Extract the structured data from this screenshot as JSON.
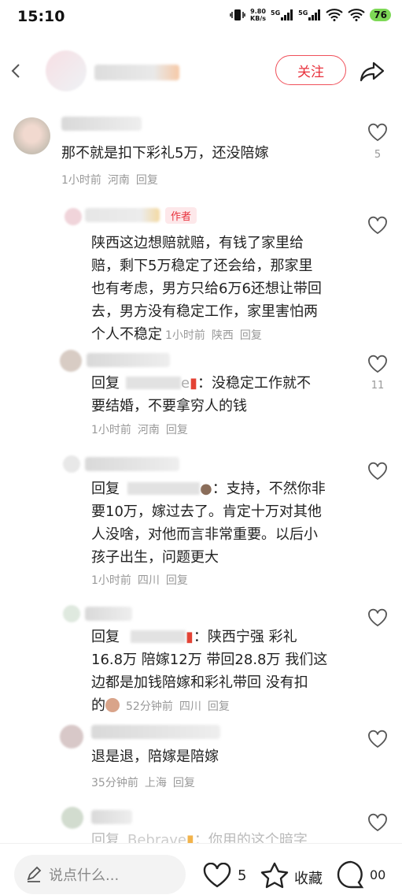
{
  "status": {
    "time": "15:10",
    "speed": "9.80",
    "speed_unit": "KB/s",
    "net1": "5G",
    "net2": "5G",
    "battery": "76"
  },
  "header": {
    "follow_label": "关注"
  },
  "comments": [
    {
      "text": "那不就是扣下彩礼5万，还没陪嫁",
      "time": "1小时前",
      "location": "河南",
      "reply": "回复",
      "likes": "5"
    },
    {
      "author_tag": "作者",
      "lines": [
        "陕西这边想赔就赔，有钱了家里给",
        "赔，剩下5万稳定了还会给，那家里",
        "也有考虑，男方只给6万6还想让带回",
        "去，男方没有稳定工作，家里害怕两",
        "个人不稳定"
      ],
      "time": "1小时前",
      "location": "陕西",
      "reply": "回复"
    },
    {
      "prefix": "回复",
      "name_visible": "e",
      "lines": [
        "：没稳定工作就不",
        "要结婚，不要拿穷人的钱"
      ],
      "time": "1小时前",
      "location": "河南",
      "reply": "回复",
      "likes": "11"
    },
    {
      "prefix": "回复",
      "lines": [
        "：支持，不然你非",
        "要10万，嫁过去了。肯定十万对其他",
        "人没啥，对他而言非常重要。以后小",
        "孩子出生，问题更大"
      ],
      "time": "1小时前",
      "location": "四川",
      "reply": "回复"
    },
    {
      "prefix": "回复",
      "lines": [
        "：陕西宁强 彩礼",
        "16.8万 陪嫁12万 带回28.8万 我们这",
        "边都是加钱陪嫁和彩礼带回 没有扣",
        "的"
      ],
      "time": "52分钟前",
      "location": "四川",
      "reply": "回复"
    },
    {
      "text": "退是退，陪嫁是陪嫁",
      "time": "35分钟前",
      "location": "上海",
      "reply": "回复"
    },
    {
      "prefix": "回复",
      "name_visible": "Bebrave",
      "text": "：你用的这个暗字"
    }
  ],
  "bottom": {
    "placeholder": "说点什么...",
    "likes": "5",
    "favorite_label": "收藏",
    "comments_count": "00"
  }
}
